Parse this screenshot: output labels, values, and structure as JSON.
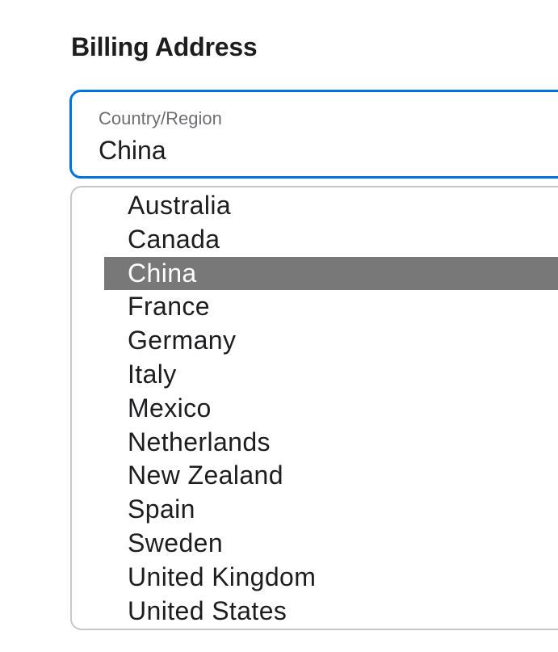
{
  "billing": {
    "title": "Billing Address"
  },
  "country_select": {
    "label": "Country/Region",
    "value": "China"
  },
  "dropdown": {
    "selected_index": 2,
    "options": [
      "Australia",
      "Canada",
      "China",
      "France",
      "Germany",
      "Italy",
      "Mexico",
      "Netherlands",
      "New Zealand",
      "Spain",
      "Sweden",
      "United Kingdom",
      "United States"
    ]
  },
  "colors": {
    "focus_border": "#0071e3",
    "selected_option_bg": "#787878"
  }
}
